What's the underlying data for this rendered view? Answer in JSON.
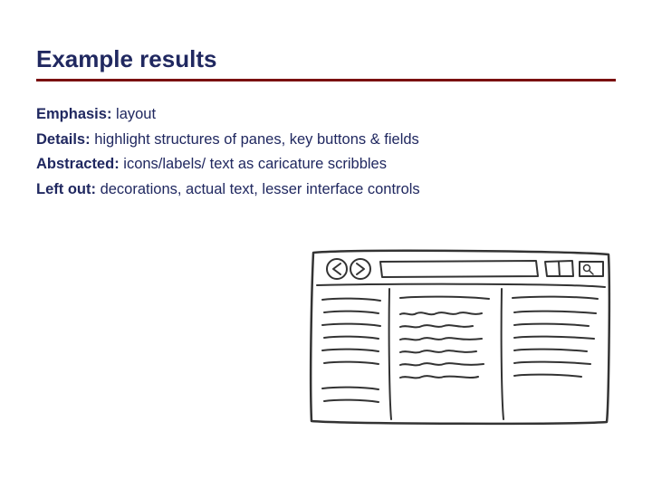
{
  "title": "Example results",
  "rows": [
    {
      "label": "Emphasis:",
      "text": " layout"
    },
    {
      "label": "Details:",
      "text": " highlight structures of panes, key buttons & fields"
    },
    {
      "label": "Abstracted:",
      "text": " icons/labels/ text as caricature scribbles"
    },
    {
      "label": "Left out:",
      "text": " decorations, actual text, lesser interface controls"
    }
  ]
}
